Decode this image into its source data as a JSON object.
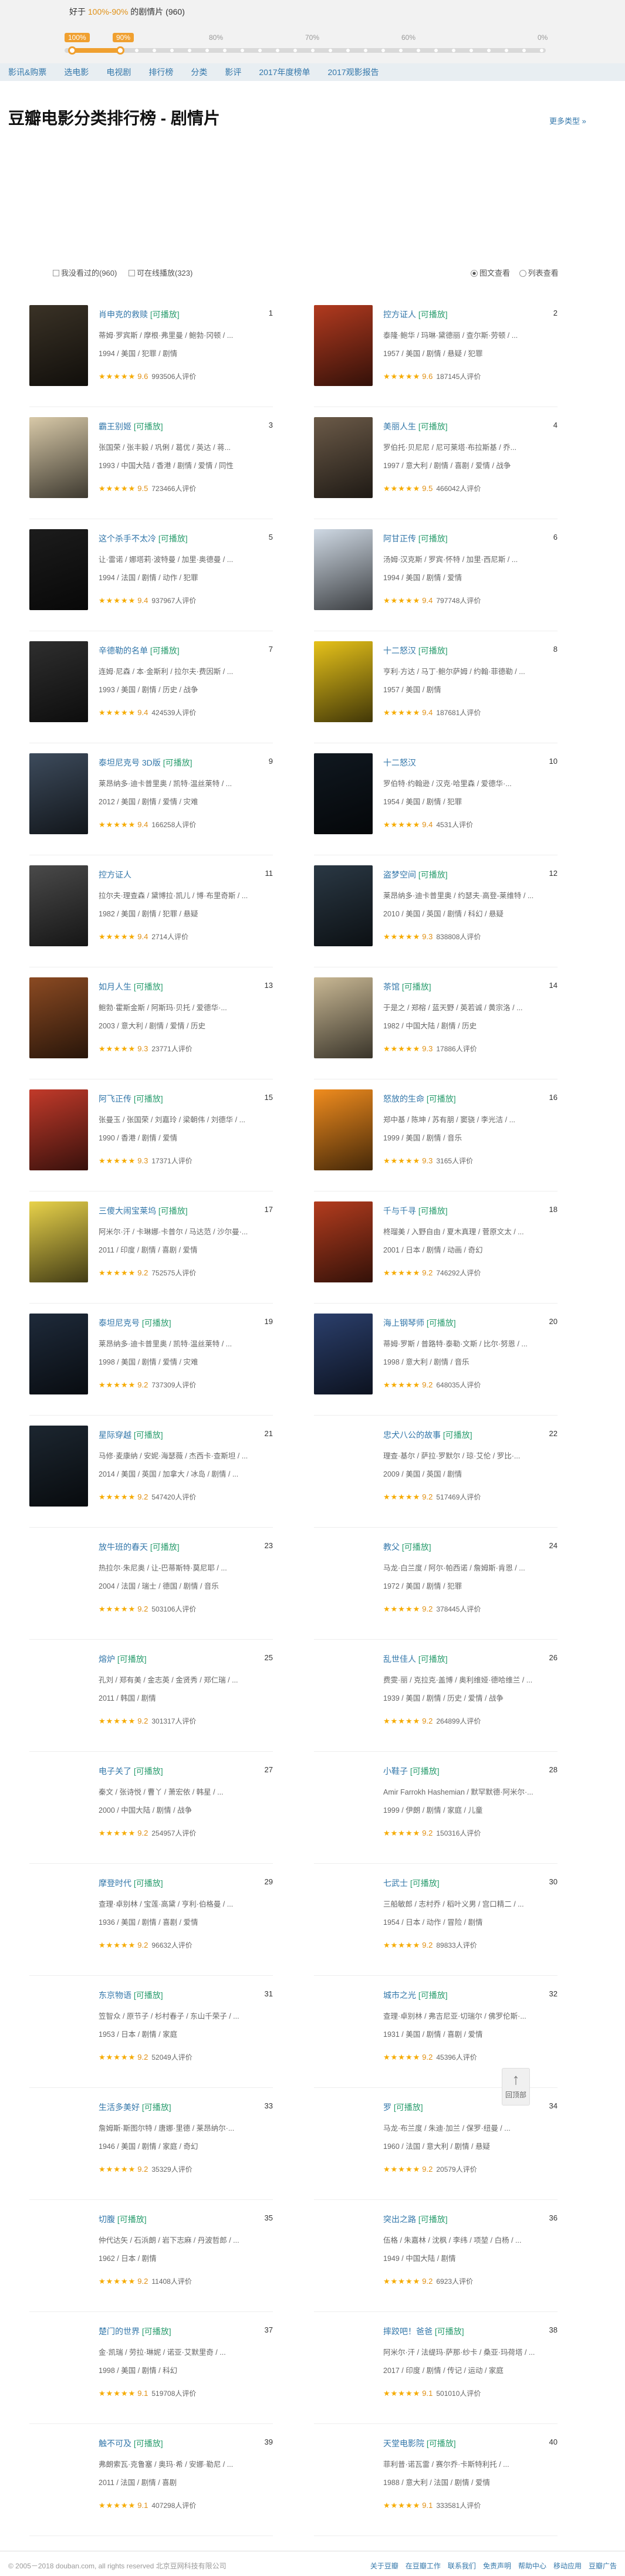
{
  "range_text": {
    "prefix": "好于 ",
    "highlight": "100%-90%",
    "suffix": " 的剧情片 (960)"
  },
  "slider": {
    "labels": [
      "100%",
      "90%",
      "80%",
      "70%",
      "60%",
      "0%"
    ],
    "filled_fraction": 0.1
  },
  "nav": [
    "影讯&购票",
    "选电影",
    "电视剧",
    "排行榜",
    "分类",
    "影评",
    "2017年度榜单",
    "2017观影报告"
  ],
  "page_title": "豆瓣电影分类排行榜 - 剧情片",
  "more_link": "更多类型 »",
  "filters": [
    {
      "label": "我没看过的(960)"
    },
    {
      "label": "可在线播放(323)"
    }
  ],
  "views": [
    {
      "label": "图文查看",
      "on": true
    },
    {
      "label": "列表查看",
      "on": false
    }
  ],
  "playable_tag": "[可播放]",
  "rating_suffix": "人评价",
  "movies": [
    {
      "rank": "1",
      "title": "肖申克的救赎",
      "playable": true,
      "crew": "蒂姆·罗宾斯 / 摩根·弗里曼 / 鲍勃·冈顿 / ...",
      "meta": "1994 / 美国 / 犯罪 / 剧情",
      "score": "9.6",
      "stars": 5,
      "votes": "993506",
      "color": "#3a3226"
    },
    {
      "rank": "2",
      "title": "控方证人",
      "playable": true,
      "crew": "泰隆·鲍华 / 玛琳·黛德丽 / 查尔斯·劳顿 / ...",
      "meta": "1957 / 美国 / 剧情 / 悬疑 / 犯罪",
      "score": "9.6",
      "stars": 5,
      "votes": "187145",
      "color": "#b23a1f"
    },
    {
      "rank": "3",
      "title": "霸王别姬",
      "playable": true,
      "crew": "张国荣 / 张丰毅 / 巩俐 / 葛优 / 英达 / 蒋...",
      "meta": "1993 / 中国大陆 / 香港 / 剧情 / 爱情 / 同性",
      "score": "9.5",
      "stars": 5,
      "votes": "723466",
      "color": "#d8c9a8"
    },
    {
      "rank": "4",
      "title": "美丽人生",
      "playable": true,
      "crew": "罗伯托·贝尼尼 / 尼可莱塔·布拉斯基 / 乔...",
      "meta": "1997 / 意大利 / 剧情 / 喜剧 / 爱情 / 战争",
      "score": "9.5",
      "stars": 5,
      "votes": "466042",
      "color": "#6b5a48"
    },
    {
      "rank": "5",
      "title": "这个杀手不太冷",
      "playable": true,
      "crew": "让·雷诺 / 娜塔莉·波特曼 / 加里·奥德曼 / ...",
      "meta": "1994 / 法国 / 剧情 / 动作 / 犯罪",
      "score": "9.4",
      "stars": 5,
      "votes": "937967",
      "color": "#1c1c1c"
    },
    {
      "rank": "6",
      "title": "阿甘正传",
      "playable": true,
      "crew": "汤姆·汉克斯 / 罗宾·怀特 / 加里·西尼斯 / ...",
      "meta": "1994 / 美国 / 剧情 / 爱情",
      "score": "9.4",
      "stars": 5,
      "votes": "797748",
      "color": "#cfd9e4"
    },
    {
      "rank": "7",
      "title": "辛德勒的名单",
      "playable": true,
      "crew": "连姆·尼森 / 本·金斯利 / 拉尔夫·费因斯 / ...",
      "meta": "1993 / 美国 / 剧情 / 历史 / 战争",
      "score": "9.4",
      "stars": 5,
      "votes": "424539",
      "color": "#2e2e2e"
    },
    {
      "rank": "8",
      "title": "十二怒汉",
      "playable": true,
      "crew": "亨利·方达 / 马丁·鲍尔萨姆 / 约翰·菲德勒 / ...",
      "meta": "1957 / 美国 / 剧情",
      "score": "9.4",
      "stars": 5,
      "votes": "187681",
      "color": "#e6c21a"
    },
    {
      "rank": "9",
      "title": "泰坦尼克号 3D版",
      "playable": true,
      "crew": "莱昂纳多·迪卡普里奥 / 凯特·温丝莱特 / ...",
      "meta": "2012 / 美国 / 剧情 / 爱情 / 灾难",
      "score": "9.4",
      "stars": 5,
      "votes": "166258",
      "color": "#3d4b5c"
    },
    {
      "rank": "10",
      "title": "十二怒汉",
      "playable": false,
      "crew": "罗伯特·约翰逊 / 汉克·哈里森 / 爱德华·...",
      "meta": "1954 / 美国 / 剧情 / 犯罪",
      "score": "9.4",
      "stars": 5,
      "votes": "4531",
      "color": "#101820"
    },
    {
      "rank": "11",
      "title": "控方证人",
      "playable": false,
      "crew": "拉尔夫·理查森 / 黛博拉·凯儿 / 博·布里奇斯 / ...",
      "meta": "1982 / 美国 / 剧情 / 犯罪 / 悬疑",
      "score": "9.4",
      "stars": 5,
      "votes": "2714",
      "color": "#4a4a4a"
    },
    {
      "rank": "12",
      "title": "盗梦空间",
      "playable": true,
      "crew": "莱昂纳多·迪卡普里奥 / 约瑟夫·高登-莱维特 / ...",
      "meta": "2010 / 美国 / 英国 / 剧情 / 科幻 / 悬疑",
      "score": "9.3",
      "stars": 5,
      "votes": "838808",
      "color": "#2a3844"
    },
    {
      "rank": "13",
      "title": "如月人生",
      "playable": true,
      "crew": "鲍勃·霍斯金斯 / 阿斯玛·贝托 / 爱德华·...",
      "meta": "2003 / 意大利 / 剧情 / 爱情 / 历史",
      "score": "9.3",
      "stars": 5,
      "votes": "23771",
      "color": "#8b4a22"
    },
    {
      "rank": "14",
      "title": "茶馆",
      "playable": true,
      "crew": "于是之 / 郑榕 / 蓝天野 / 英若诚 / 黄宗洛 / ...",
      "meta": "1982 / 中国大陆 / 剧情 / 历史",
      "score": "9.3",
      "stars": 5,
      "votes": "17886",
      "color": "#c9b894"
    },
    {
      "rank": "15",
      "title": "阿飞正传",
      "playable": true,
      "crew": "张曼玉 / 张国荣 / 刘嘉玲 / 梁朝伟 / 刘德华 / ...",
      "meta": "1990 / 香港 / 剧情 / 爱情",
      "score": "9.3",
      "stars": 5,
      "votes": "17371",
      "color": "#c23a2a"
    },
    {
      "rank": "16",
      "title": "怒放的生命",
      "playable": true,
      "crew": "郑中基 / 陈坤 / 苏有朋 / 窦骁 / 李光洁 / ...",
      "meta": "1999 / 美国 / 剧情 / 音乐",
      "score": "9.3",
      "stars": 5,
      "votes": "3165",
      "color": "#f08c1e"
    },
    {
      "rank": "17",
      "title": "三傻大闹宝莱坞",
      "playable": true,
      "crew": "阿米尔·汗 / 卡琳娜·卡普尔 / 马达范 / 沙尔曼·...",
      "meta": "2011 / 印度 / 剧情 / 喜剧 / 爱情",
      "score": "9.2",
      "stars": 5,
      "votes": "752575",
      "color": "#e8d24a"
    },
    {
      "rank": "18",
      "title": "千与千寻",
      "playable": true,
      "crew": "柊瑠美 / 入野自由 / 夏木真理 / 菅原文太 / ...",
      "meta": "2001 / 日本 / 剧情 / 动画 / 奇幻",
      "score": "9.2",
      "stars": 5,
      "votes": "746292",
      "color": "#b33c1e"
    },
    {
      "rank": "19",
      "title": "泰坦尼克号",
      "playable": true,
      "crew": "莱昂纳多·迪卡普里奥 / 凯特·温丝莱特 / ...",
      "meta": "1998 / 美国 / 剧情 / 爱情 / 灾难",
      "score": "9.2",
      "stars": 5,
      "votes": "737309",
      "color": "#1e2a3a"
    },
    {
      "rank": "20",
      "title": "海上钢琴师",
      "playable": true,
      "crew": "蒂姆·罗斯 / 普路特·泰勒·文斯 / 比尔·努恩 / ...",
      "meta": "1998 / 意大利 / 剧情 / 音乐",
      "score": "9.2",
      "stars": 5,
      "votes": "648035",
      "color": "#2b3f6c"
    },
    {
      "rank": "21",
      "title": "星际穿越",
      "playable": true,
      "crew": "马修·麦康纳 / 安妮·海瑟薇 / 杰西卡·查斯坦 / ...",
      "meta": "2014 / 美国 / 英国 / 加拿大 / 冰岛 / 剧情 / ...",
      "score": "9.2",
      "stars": 5,
      "votes": "547420",
      "color": "#1c2630"
    },
    {
      "rank": "22",
      "title": "忠犬八公的故事",
      "playable": true,
      "crew": "理查·基尔 / 萨拉·罗默尔 / 琼·艾伦 / 罗比·...",
      "meta": "2009 / 美国 / 英国 / 剧情",
      "score": "9.2",
      "stars": 5,
      "votes": "517469",
      "color": "#ffffff"
    },
    {
      "rank": "23",
      "title": "放牛班的春天",
      "playable": true,
      "crew": "热拉尔·朱尼奥 / 让-巴蒂斯特·莫尼耶 / ...",
      "meta": "2004 / 法国 / 瑞士 / 德国 / 剧情 / 音乐",
      "score": "9.2",
      "stars": 5,
      "votes": "503106",
      "color": "#ffffff"
    },
    {
      "rank": "24",
      "title": "教父",
      "playable": true,
      "crew": "马龙·白兰度 / 阿尔·帕西诺 / 詹姆斯·肯恩 / ...",
      "meta": "1972 / 美国 / 剧情 / 犯罪",
      "score": "9.2",
      "stars": 5,
      "votes": "378445",
      "color": "#ffffff"
    },
    {
      "rank": "25",
      "title": "熔炉",
      "playable": true,
      "crew": "孔刘 / 郑有美 / 金志英 / 金贤秀 / 郑仁瑞 / ...",
      "meta": "2011 / 韩国 / 剧情",
      "score": "9.2",
      "stars": 5,
      "votes": "301317",
      "color": "#ffffff"
    },
    {
      "rank": "26",
      "title": "乱世佳人",
      "playable": true,
      "crew": "费雯·丽 / 克拉克·盖博 / 奥利维娅·德哈维兰 / ...",
      "meta": "1939 / 美国 / 剧情 / 历史 / 爱情 / 战争",
      "score": "9.2",
      "stars": 5,
      "votes": "264899",
      "color": "#ffffff"
    },
    {
      "rank": "27",
      "title": "电子关了",
      "playable": true,
      "crew": "秦文 / 张诗悦 / 曹丫 / 萧宏依 / 韩星 / ...",
      "meta": "2000 / 中国大陆 / 剧情 / 战争",
      "score": "9.2",
      "stars": 5,
      "votes": "254957",
      "color": "#ffffff"
    },
    {
      "rank": "28",
      "title": "小鞋子",
      "playable": true,
      "crew": "Amir Farrokh Hashemian / 默罕默德·阿米尔·...",
      "meta": "1999 / 伊朗 / 剧情 / 家庭 / 儿童",
      "score": "9.2",
      "stars": 5,
      "votes": "150316",
      "color": "#ffffff"
    },
    {
      "rank": "29",
      "title": "摩登时代",
      "playable": true,
      "crew": "查理·卓别林 / 宝莲·高黛 / 亨利·伯格曼 / ...",
      "meta": "1936 / 美国 / 剧情 / 喜剧 / 爱情",
      "score": "9.2",
      "stars": 5,
      "votes": "96632",
      "color": "#ffffff"
    },
    {
      "rank": "30",
      "title": "七武士",
      "playable": true,
      "crew": "三船敏郎 / 志村乔 / 稻叶义男 / 宫口精二 / ...",
      "meta": "1954 / 日本 / 动作 / 冒险 / 剧情",
      "score": "9.2",
      "stars": 5,
      "votes": "89833",
      "color": "#ffffff"
    },
    {
      "rank": "31",
      "title": "东京物语",
      "playable": true,
      "crew": "笠智众 / 原节子 / 杉村春子 / 东山千荣子 / ...",
      "meta": "1953 / 日本 / 剧情 / 家庭",
      "score": "9.2",
      "stars": 5,
      "votes": "52049",
      "color": "#ffffff"
    },
    {
      "rank": "32",
      "title": "城市之光",
      "playable": true,
      "crew": "查理·卓别林 / 弗吉尼亚·切瑞尔 / 佛罗伦斯·...",
      "meta": "1931 / 美国 / 剧情 / 喜剧 / 爱情",
      "score": "9.2",
      "stars": 5,
      "votes": "45396",
      "color": "#ffffff"
    },
    {
      "rank": "33",
      "title": "生活多美好",
      "playable": true,
      "crew": "詹姆斯·斯图尔特 / 唐娜·里德 / 莱昂纳尔·...",
      "meta": "1946 / 美国 / 剧情 / 家庭 / 奇幻",
      "score": "9.2",
      "stars": 5,
      "votes": "35329",
      "color": "#ffffff"
    },
    {
      "rank": "34",
      "title": "罗",
      "playable": true,
      "crew": "马龙·布兰度 / 朱迪·加兰 / 保罗·纽曼 / ...",
      "meta": "1960 / 法国 / 意大利 / 剧情 / 悬疑",
      "score": "9.2",
      "stars": 5,
      "votes": "20579",
      "color": "#ffffff"
    },
    {
      "rank": "35",
      "title": "切腹",
      "playable": true,
      "crew": "仲代达矢 / 石浜朗 / 岩下志麻 / 丹波哲郎 / ...",
      "meta": "1962 / 日本 / 剧情",
      "score": "9.2",
      "stars": 5,
      "votes": "11408",
      "color": "#ffffff"
    },
    {
      "rank": "36",
      "title": "突出之路",
      "playable": true,
      "crew": "伍格 / 朱嘉林 / 沈枫 / 李纬 / 项堃 / 白杨 / ...",
      "meta": "1949 / 中国大陆 / 剧情",
      "score": "9.2",
      "stars": 5,
      "votes": "6923",
      "color": "#ffffff"
    },
    {
      "rank": "37",
      "title": "楚门的世界",
      "playable": true,
      "crew": "金·凯瑞 / 劳拉·琳妮 / 诺亚·艾默里奇 / ...",
      "meta": "1998 / 美国 / 剧情 / 科幻",
      "score": "9.1",
      "stars": 5,
      "votes": "519708",
      "color": "#ffffff"
    },
    {
      "rank": "38",
      "title": "摔跤吧！爸爸",
      "playable": true,
      "crew": "阿米尔·汗 / 法缇玛·萨那·纱卡 / 桑亚·玛荷塔 / ...",
      "meta": "2017 / 印度 / 剧情 / 传记 / 运动 / 家庭",
      "score": "9.1",
      "stars": 5,
      "votes": "501010",
      "color": "#ffffff"
    },
    {
      "rank": "39",
      "title": "触不可及",
      "playable": true,
      "crew": "弗朗索瓦·克鲁塞 / 奥玛·希 / 安娜·勒尼 / ...",
      "meta": "2011 / 法国 / 剧情 / 喜剧",
      "score": "9.1",
      "stars": 5,
      "votes": "407298",
      "color": "#ffffff"
    },
    {
      "rank": "40",
      "title": "天堂电影院",
      "playable": true,
      "crew": "菲利普·诺瓦雷 / 赛尔乔·卡斯特利托 / ...",
      "meta": "1988 / 意大利 / 法国 / 剧情 / 爱情",
      "score": "9.1",
      "stars": 5,
      "votes": "333581",
      "color": "#ffffff"
    }
  ],
  "back_to_top": "回顶部",
  "footer": {
    "copyright": "© 2005－2018 douban.com, all rights reserved 北京豆网科技有限公司",
    "links": [
      "关于豆瓣",
      "在豆瓣工作",
      "联系我们",
      "免责声明",
      "帮助中心",
      "移动应用",
      "豆瓣广告"
    ]
  }
}
